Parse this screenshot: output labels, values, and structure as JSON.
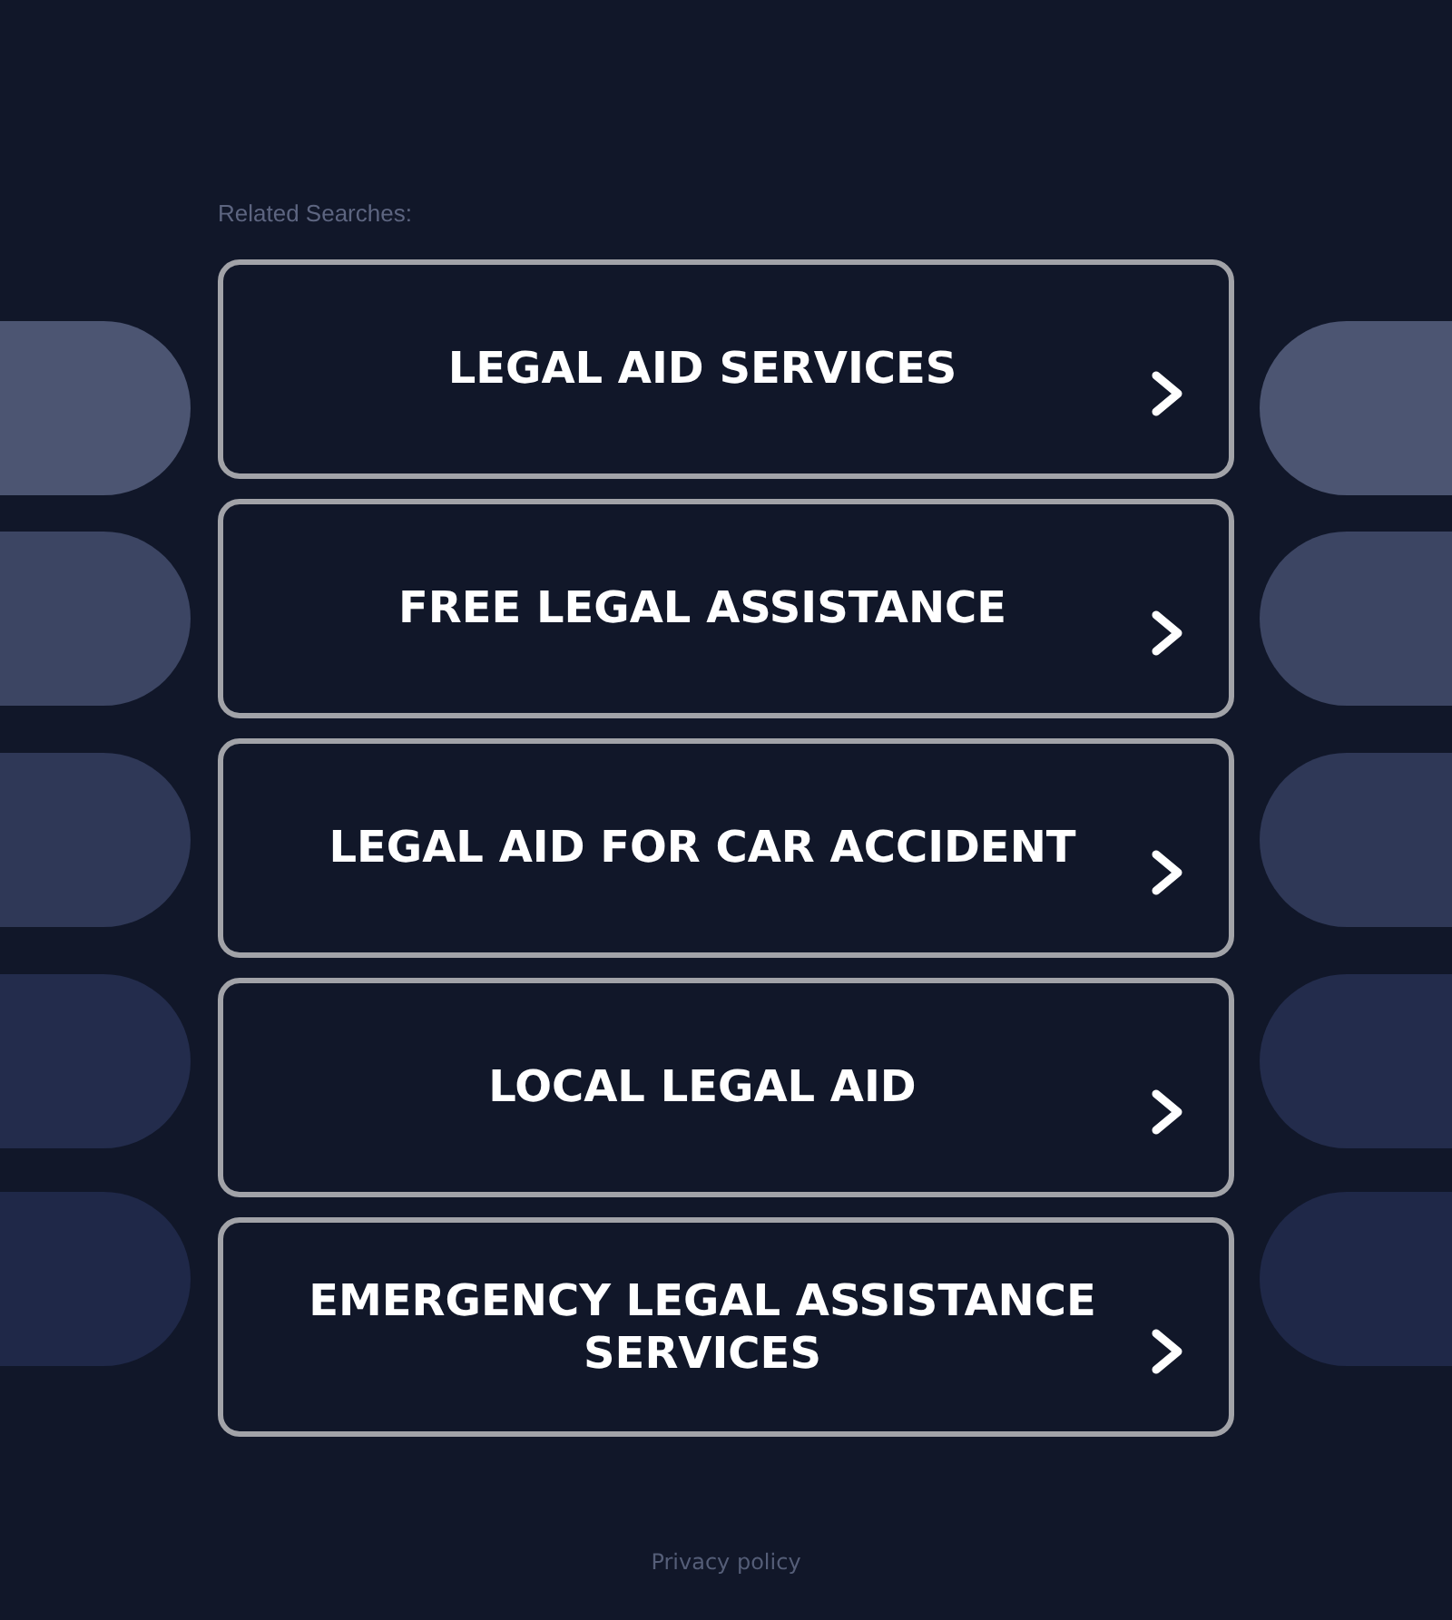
{
  "heading": "Related Searches:",
  "links": [
    {
      "label": "LEGAL AID SERVICES"
    },
    {
      "label": "FREE LEGAL ASSISTANCE"
    },
    {
      "label": "LEGAL AID FOR CAR ACCIDENT"
    },
    {
      "label": "LOCAL LEGAL AID"
    },
    {
      "label": "EMERGENCY LEGAL ASSISTANCE SERVICES"
    }
  ],
  "footer": {
    "privacy_link": "Privacy policy"
  }
}
